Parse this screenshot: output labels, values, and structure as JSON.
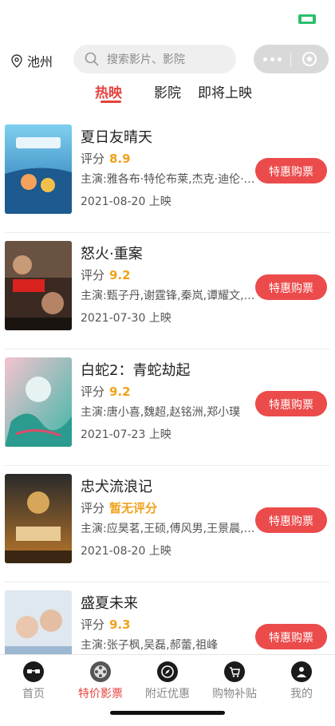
{
  "header": {
    "city": "池州",
    "search_placeholder": "搜索影片、影院"
  },
  "tabs": [
    {
      "label": "热映",
      "active": true
    },
    {
      "label": "影院",
      "active": false
    },
    {
      "label": "即将上映",
      "active": false
    }
  ],
  "rating_label": "评分",
  "movies": [
    {
      "title": "夏日友晴天",
      "rating": "8.9",
      "cast": "主演:雅各布·特伦布莱,杰克·迪伦·格雷泽",
      "release": "2021-08-20 上映",
      "button": "特惠购票"
    },
    {
      "title": "怒火·重案",
      "rating": "9.2",
      "cast": "主演:甄子丹,谢霆锋,秦岚,谭耀文,吴樾",
      "release": "2021-07-30 上映",
      "button": "特惠购票"
    },
    {
      "title": "白蛇2：青蛇劫起",
      "rating": "9.2",
      "cast": "主演:唐小喜,魏超,赵铭洲,郑小璞",
      "release": "2021-07-23 上映",
      "button": "特惠购票"
    },
    {
      "title": "忠犬流浪记",
      "rating": "暂无评分",
      "cast": "主演:应昊茗,王硕,傅风男,王景晨,刘丹",
      "release": "2021-08-20 上映",
      "button": "特惠购票"
    },
    {
      "title": "盛夏未来",
      "rating": "9.3",
      "cast": "主演:张子枫,吴磊,郝蕾,祖峰",
      "release": "",
      "button": "特惠购票"
    }
  ],
  "tabbar": [
    {
      "label": "首页",
      "icon": "home-face-icon",
      "active": false
    },
    {
      "label": "特价影票",
      "icon": "film-reel-icon",
      "active": true
    },
    {
      "label": "附近优惠",
      "icon": "compass-icon",
      "active": false
    },
    {
      "label": "购物补贴",
      "icon": "cart-icon",
      "active": false
    },
    {
      "label": "我的",
      "icon": "profile-icon",
      "active": false
    }
  ],
  "colors": {
    "accent": "#e4433f",
    "button": "#ec4b4b",
    "rating": "#f0a11b"
  }
}
